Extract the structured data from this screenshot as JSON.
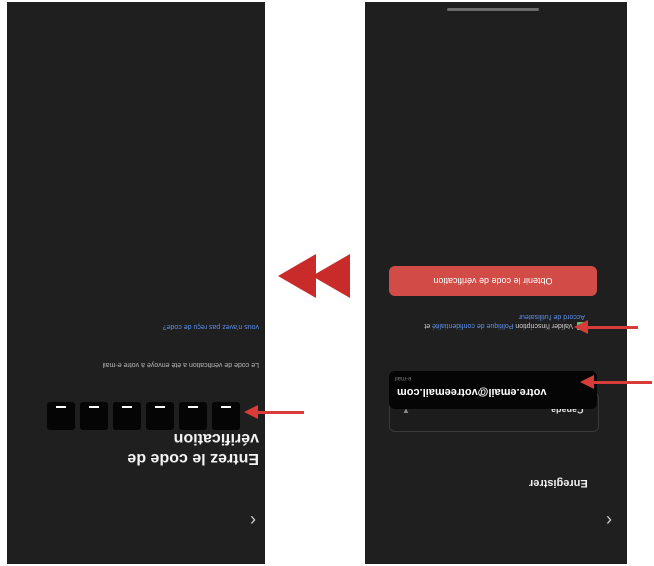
{
  "left_screen": {
    "title": "Entrez le code de vérification",
    "sent_text": "Le code de vérification a été envoyé à votre e-mail",
    "resend_link": "vous n'avez pas reçu de code?",
    "otp_boxes": 6,
    "back_icon": "chevron-right-icon"
  },
  "right_screen": {
    "title": "Enregistrer",
    "country": "Canada",
    "email_label": "e-mail",
    "email_value": "votre.email@votreemail.com",
    "agree_prefix": "Valider l'inscription",
    "privacy_link": "Politique de confidentialité",
    "and_word": "et",
    "terms_link": "Accord de l'utilisateur",
    "button": "Obtenir le code de vérification",
    "back_icon": "chevron-right-icon"
  },
  "colors": {
    "arrow": "#d83c38",
    "button": "#d24c47",
    "check": "#58c779",
    "link": "#5a8fe8"
  }
}
